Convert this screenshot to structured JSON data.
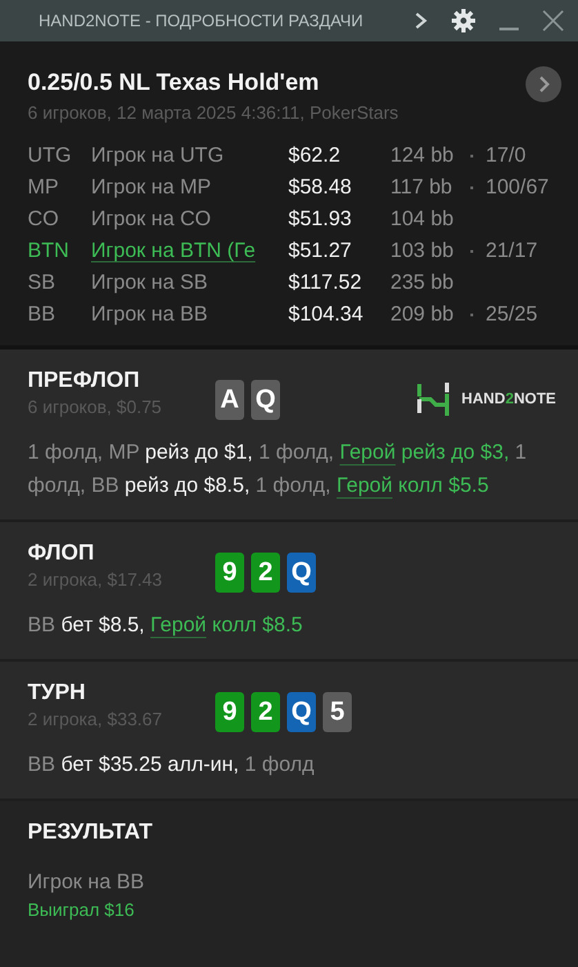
{
  "window": {
    "title": "HAND2NOTE - ПОДРОБНОСТИ РАЗДАЧИ"
  },
  "hand": {
    "title": "0.25/0.5 NL Texas Hold'em",
    "subtitle": "6 игроков, 12 марта 2025 4:36:11, PokerStars"
  },
  "players": [
    {
      "position": "UTG",
      "name": "Игрок на UTG",
      "stack": "$62.2",
      "bb": "124 bb",
      "stats": "17/0",
      "hero": false
    },
    {
      "position": "MP",
      "name": "Игрок на MP",
      "stack": "$58.48",
      "bb": "117 bb",
      "stats": "100/67",
      "hero": false
    },
    {
      "position": "CO",
      "name": "Игрок на CO",
      "stack": "$51.93",
      "bb": "104 bb",
      "hero": false
    },
    {
      "position": "BTN",
      "name": "Игрок на BTN (Ге",
      "stack": "$51.27",
      "bb": "103 bb",
      "stats": "21/17",
      "hero": true
    },
    {
      "position": "SB",
      "name": "Игрок на SB",
      "stack": "$117.52",
      "bb": "235 bb",
      "hero": false
    },
    {
      "position": "BB",
      "name": "Игрок на BB",
      "stack": "$104.34",
      "bb": "209 bb",
      "stats": "25/25",
      "hero": false
    }
  ],
  "streets": [
    {
      "title": "ПРЕФЛОП",
      "subtitle": "6 игроков, $0.75",
      "logo": {
        "before": "HAND",
        "accent": "2",
        "after": "NOTE"
      },
      "cards": [
        {
          "rank": "A",
          "color": "#5c5c5c"
        },
        {
          "rank": "Q",
          "color": "#5c5c5c"
        }
      ],
      "actions": [
        {
          "kind": "plain",
          "text": "1 фолд, MP "
        },
        {
          "kind": "action",
          "text": "рейз до $1,"
        },
        {
          "kind": "plain",
          "text": " 1 фолд, "
        },
        {
          "kind": "hero",
          "text": "Герой"
        },
        {
          "kind": "hero_action",
          "text": " рейз до $3,"
        },
        {
          "kind": "plain",
          "text": " 1 фолд, BB "
        },
        {
          "kind": "action",
          "text": "рейз до $8.5,"
        },
        {
          "kind": "plain",
          "text": " 1 фолд, "
        },
        {
          "kind": "hero",
          "text": "Герой"
        },
        {
          "kind": "hero_action",
          "text": " колл $5.5"
        }
      ]
    },
    {
      "title": "ФЛОП",
      "subtitle": "2 игрока, $17.43",
      "cards": [
        {
          "rank": "9",
          "color": "#12961c"
        },
        {
          "rank": "2",
          "color": "#12961c"
        },
        {
          "rank": "Q",
          "color": "#1565b5"
        }
      ],
      "actions": [
        {
          "kind": "plain",
          "text": "BB "
        },
        {
          "kind": "action",
          "text": "бет $8.5, "
        },
        {
          "kind": "hero",
          "text": "Герой"
        },
        {
          "kind": "hero_action",
          "text": " колл $8.5"
        }
      ]
    },
    {
      "title": "ТУРН",
      "subtitle": "2 игрока, $33.67",
      "cards": [
        {
          "rank": "9",
          "color": "#12961c"
        },
        {
          "rank": "2",
          "color": "#12961c"
        },
        {
          "rank": "Q",
          "color": "#1565b5"
        },
        {
          "rank": "5",
          "color": "#5c5c5c"
        }
      ],
      "actions": [
        {
          "kind": "plain",
          "text": "BB "
        },
        {
          "kind": "action",
          "text": "бет $35.25 алл-ин,"
        },
        {
          "kind": "plain",
          "text": " 1 фолд"
        }
      ]
    }
  ],
  "result": {
    "title": "РЕЗУЛЬТАТ",
    "player": "Игрок на BB",
    "outcome": "Выиграл $16"
  }
}
